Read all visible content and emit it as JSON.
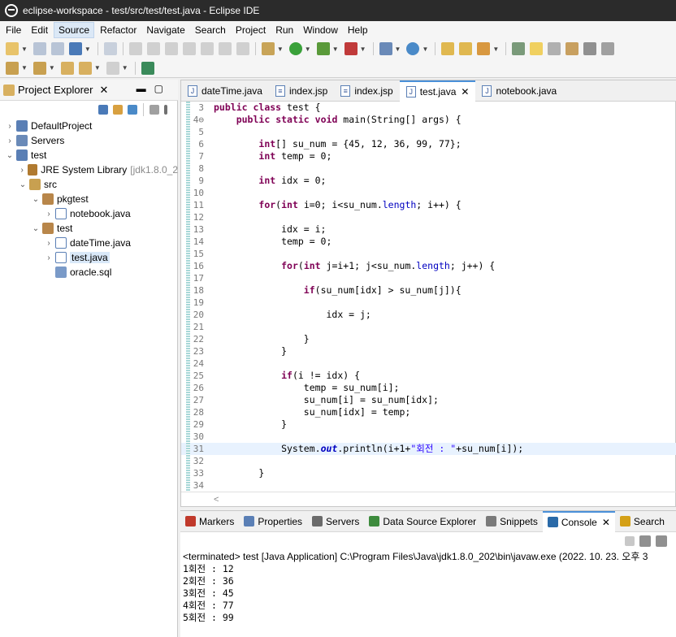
{
  "window": {
    "title": "eclipse-workspace - test/src/test/test.java - Eclipse IDE"
  },
  "menu": [
    "File",
    "Edit",
    "Source",
    "Refactor",
    "Navigate",
    "Search",
    "Project",
    "Run",
    "Window",
    "Help"
  ],
  "menu_active": "Source",
  "explorer": {
    "tab_label": "Project Explorer",
    "items": [
      {
        "label": "DefaultProject",
        "arrow": "›",
        "kind": "project"
      },
      {
        "label": "Servers",
        "arrow": "›",
        "kind": "folder"
      },
      {
        "label": "test",
        "arrow": "⌄",
        "kind": "project"
      },
      {
        "label": "JRE System Library",
        "suffix": "[jdk1.8.0_2",
        "arrow": "›",
        "kind": "library"
      },
      {
        "label": "src",
        "arrow": "⌄",
        "kind": "package-root"
      },
      {
        "label": "pkgtest",
        "arrow": "⌄",
        "kind": "package"
      },
      {
        "label": "notebook.java",
        "arrow": "›",
        "kind": "java"
      },
      {
        "label": "test",
        "arrow": "⌄",
        "kind": "package"
      },
      {
        "label": "dateTime.java",
        "arrow": "›",
        "kind": "java"
      },
      {
        "label": "test.java",
        "arrow": "›",
        "kind": "java",
        "selected": true
      },
      {
        "label": "oracle.sql",
        "arrow": "",
        "kind": "sql"
      }
    ]
  },
  "editor": {
    "tabs": [
      {
        "label": "dateTime.java",
        "icon": "J",
        "active": false
      },
      {
        "label": "index.jsp",
        "icon": "≡",
        "active": false
      },
      {
        "label": "index.jsp",
        "icon": "≡",
        "active": false
      },
      {
        "label": "test.java",
        "icon": "J",
        "active": true
      },
      {
        "label": "notebook.java",
        "icon": "J",
        "active": false
      }
    ],
    "lines": [
      {
        "n": "3",
        "code": "public class test {"
      },
      {
        "n": "4⊖",
        "code": "    public static void main(String[] args) {"
      },
      {
        "n": "5",
        "code": ""
      },
      {
        "n": "6",
        "code": "        int[] su_num = {45, 12, 36, 99, 77};"
      },
      {
        "n": "7",
        "code": "        int temp = 0;"
      },
      {
        "n": "8",
        "code": ""
      },
      {
        "n": "9",
        "code": "        int idx = 0;"
      },
      {
        "n": "10",
        "code": ""
      },
      {
        "n": "11",
        "code": "        for(int i=0; i<su_num.length; i++) {"
      },
      {
        "n": "12",
        "code": ""
      },
      {
        "n": "13",
        "code": "            idx = i;"
      },
      {
        "n": "14",
        "code": "            temp = 0;"
      },
      {
        "n": "15",
        "code": ""
      },
      {
        "n": "16",
        "code": "            for(int j=i+1; j<su_num.length; j++) {"
      },
      {
        "n": "17",
        "code": ""
      },
      {
        "n": "18",
        "code": "                if(su_num[idx] > su_num[j]){"
      },
      {
        "n": "19",
        "code": ""
      },
      {
        "n": "20",
        "code": "                    idx = j;"
      },
      {
        "n": "21",
        "code": ""
      },
      {
        "n": "22",
        "code": "                }"
      },
      {
        "n": "23",
        "code": "            }"
      },
      {
        "n": "24",
        "code": ""
      },
      {
        "n": "25",
        "code": "            if(i != idx) {"
      },
      {
        "n": "26",
        "code": "                temp = su_num[i];"
      },
      {
        "n": "27",
        "code": "                su_num[i] = su_num[idx];"
      },
      {
        "n": "28",
        "code": "                su_num[idx] = temp;"
      },
      {
        "n": "29",
        "code": "            }"
      },
      {
        "n": "30",
        "code": ""
      },
      {
        "n": "31",
        "code": "            System.out.println(i+1+\"회전 : \"+su_num[i]);",
        "current": true
      },
      {
        "n": "32",
        "code": ""
      },
      {
        "n": "33",
        "code": "        }"
      },
      {
        "n": "34",
        "code": ""
      }
    ],
    "scroll_arrow": "<"
  },
  "console": {
    "tabs": [
      {
        "label": "Markers",
        "color": "#c0392b"
      },
      {
        "label": "Properties",
        "color": "#5a7fb5"
      },
      {
        "label": "Servers",
        "color": "#6a6a6a"
      },
      {
        "label": "Data Source Explorer",
        "color": "#3d8b3d"
      },
      {
        "label": "Snippets",
        "color": "#7a7a7a"
      },
      {
        "label": "Console",
        "color": "#2a6aa8",
        "active": true
      },
      {
        "label": "Search",
        "color": "#d4a017"
      }
    ],
    "terminated": "<terminated> test [Java Application] C:\\Program Files\\Java\\jdk1.8.0_202\\bin\\javaw.exe  (2022. 10. 23. 오후 3",
    "output": [
      "1회전 : 12",
      "2회전 : 36",
      "3회전 : 45",
      "4회전 : 77",
      "5회전 : 99"
    ]
  }
}
